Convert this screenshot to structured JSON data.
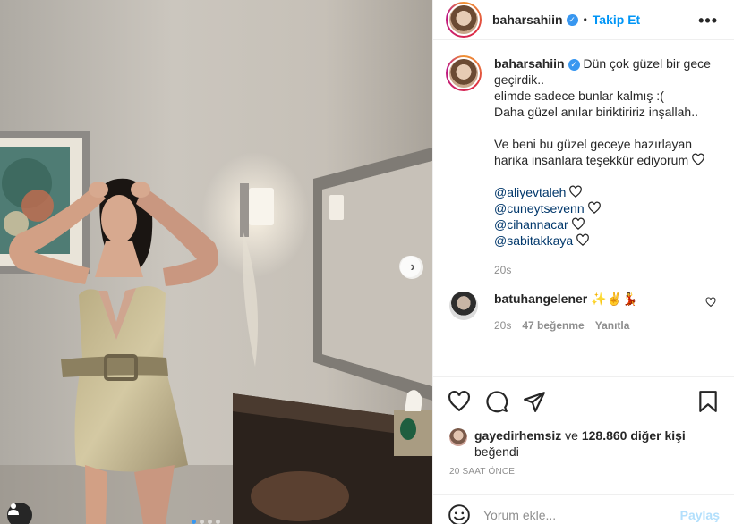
{
  "post": {
    "username": "baharsahiin",
    "verified_icon": "verified-badge-icon",
    "header_separator": "•",
    "follow_label": "Takip Et",
    "more_icon": "more-options-icon"
  },
  "caption": {
    "lines": [
      "Dün çok güzel bir gece",
      "geçirdik..",
      "elimde sadece bunlar kalmış :(",
      "Daha güzel anılar biriktiririz inşallah..",
      "",
      "Ve beni bu güzel geceye hazırlayan",
      "harika insanlara teşekkür ediyorum"
    ],
    "mentions": [
      "@aliyevtaleh",
      "@cuneytsevenn",
      "@cihannacar",
      "@sabitakkaya"
    ],
    "time": "20s"
  },
  "comment": {
    "username": "batuhangelener",
    "emojis": "✨✌️💃",
    "time": "20s",
    "likes": "47 beğenme",
    "reply_label": "Yanıtla"
  },
  "actions": {
    "icons": [
      "heart-icon",
      "comment-icon",
      "share-icon",
      "bookmark-icon"
    ]
  },
  "likes": {
    "user": "gayedirhemsiz",
    "connector": "ve",
    "others": "128.860 diğer kişi",
    "suffix": "beğendi"
  },
  "post_time": "20 SAAT ÖNCE",
  "add_comment": {
    "placeholder": "Yorum ekle...",
    "post_label": "Paylaş"
  },
  "carousel": {
    "next_icon": "chevron-right-icon",
    "dots_count": 4,
    "active_dot": 0
  },
  "colors": {
    "accent": "#0095f6",
    "verified": "#3897f0",
    "mention": "#00376b",
    "muted": "#8e8e8e"
  }
}
